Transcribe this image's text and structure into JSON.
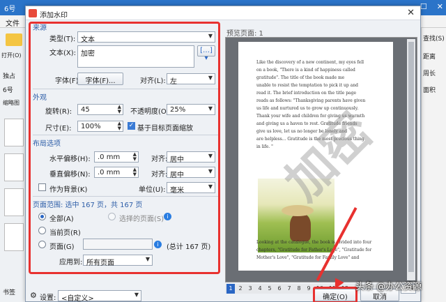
{
  "app": {
    "tab": "6号",
    "menu_file": "文件",
    "open_label": "打开(O)",
    "left_items": [
      "独占",
      "6号",
      "缩略图",
      "书签"
    ],
    "right_items": [
      "查找(S)",
      "距离",
      "周长",
      "面积"
    ]
  },
  "dialog": {
    "title": "添加水印",
    "source": {
      "section": "来源",
      "type_label": "类型(T):",
      "type_value": "文本",
      "text_label": "文本(X):",
      "text_value": "加密",
      "font_label": "字体(F):",
      "font_button": "字体(F)...",
      "align_label": "对齐(L):",
      "align_value": "左"
    },
    "appearance": {
      "section": "外观",
      "rotation_label": "旋转(R):",
      "rotation_value": "45",
      "opacity_label": "不透明度(O):",
      "opacity_value": "25%",
      "size_label": "尺寸(E):",
      "size_value": "100%",
      "scale_checkbox": "基于目标页面缩放"
    },
    "layout": {
      "section": "布局选项",
      "h_offset_label": "水平偏移(H):",
      "h_offset_value": ".0 mm",
      "h_align_label": "对齐:",
      "h_align_value": "居中",
      "v_offset_label": "垂直偏移(N):",
      "v_offset_value": ".0 mm",
      "v_align_label": "对齐:",
      "v_align_value": "居中",
      "background_checkbox": "作为背景(K)",
      "unit_label": "单位(U):",
      "unit_value": "毫米"
    },
    "page_range": {
      "summary": "页面范围: 选中 167 页，共 167 页",
      "all_label": "全部(A)",
      "selected_label": "选择的页面(S)",
      "current_label": "当前页(R)",
      "pages_label": "页面(G)",
      "total_text": "(总计 167 页)",
      "apply_label": "应用到:",
      "apply_value": "所有页面"
    },
    "preview": {
      "title": "预览页面: 1",
      "lines": [
        "Like the discovery of a new continent, my eyes fell",
        "on a book, \"There is a kind of happiness called",
        "gratitude\". The title of the book made me",
        "unable to resist the temptation to pick it up and",
        "read it. The brief introduction on the title page",
        "reads as follows: \"Thanksgiving parents have given",
        "us life and nurtured us to grow up continuously.",
        "Thank your wife and children for giving us warmth",
        "and giving us a haven to rest. Gratitude friends",
        "give us love, let us no longer be lonely and",
        "are helpless... Gratitude is the most precious thing",
        "in life. \""
      ],
      "lines_after": [
        "Looking at the catalogue, the book is divided into four",
        "chapters, \"Gratitude for Father's Love\", \"Gratitude for",
        "Mother's Love\", \"Gratitude for Family Love\" and"
      ],
      "watermark": "加密",
      "pages": [
        "1",
        "2",
        "3",
        "4",
        "5",
        "6",
        "7",
        "8",
        "9",
        "10",
        "11",
        "12"
      ],
      "page_input": "1"
    },
    "bottom": {
      "settings_label": "设置:",
      "settings_value": "<自定义>",
      "ok_label": "确定(O)",
      "cancel_label": "取消"
    }
  },
  "overlay": {
    "watermark_text": "头条 @办公资源"
  },
  "colors": {
    "highlight": "#e8312f",
    "accent": "#2a66c4"
  }
}
